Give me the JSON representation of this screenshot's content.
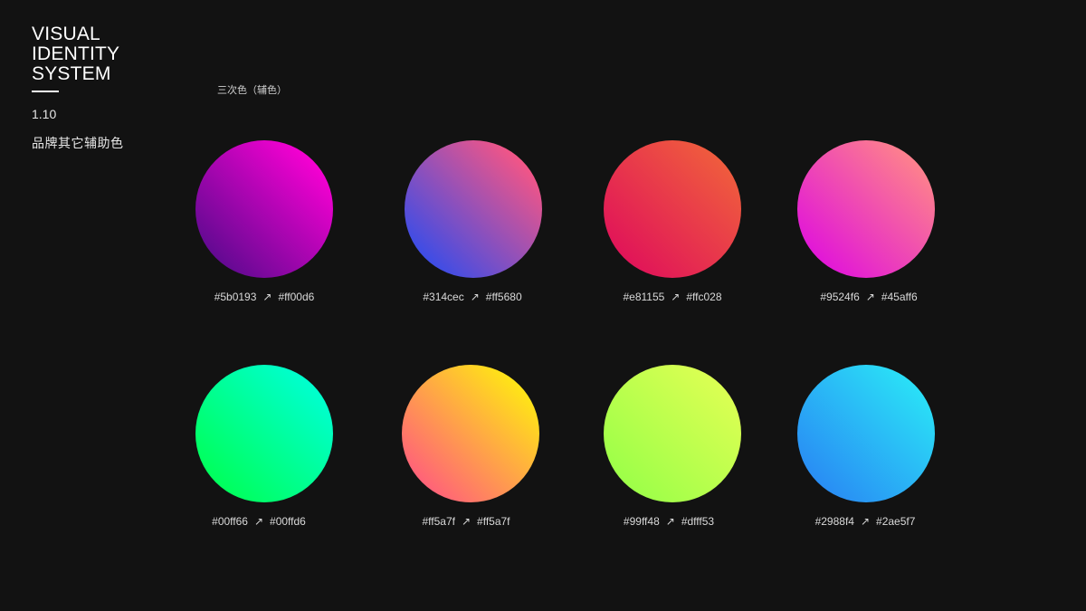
{
  "header": {
    "title_lines": [
      "VISUAL",
      "IDENTITY",
      "SYSTEM"
    ],
    "section_number": "1.10",
    "section_name": "品牌其它辅助色"
  },
  "palette": {
    "heading": "三次色（辅色）",
    "arrow_symbol": "↗",
    "swatches": [
      {
        "from": "#5b0193",
        "to": "#ff00d6"
      },
      {
        "from": "#314cec",
        "to": "#ff5680"
      },
      {
        "from": "#e81155",
        "to": "#ffc028"
      },
      {
        "from": "#9524f6",
        "to": "#45aff6"
      },
      {
        "from": "#00ff66",
        "to": "#00ffd6"
      },
      {
        "from": "#ff5a7f",
        "to": "#ff5a7f"
      },
      {
        "from": "#99ff48",
        "to": "#dfff53"
      },
      {
        "from": "#2988f4",
        "to": "#2ae5f7"
      }
    ]
  },
  "colors": {
    "background": "#121212",
    "text": "#ffffff",
    "swatch_fills": [
      [
        "#5a0a8e",
        "#ff00d6"
      ],
      [
        "#314cec",
        "#ff5680"
      ],
      [
        "#e0105a",
        "#f0603c"
      ],
      [
        "#e010dc",
        "#ff8888"
      ],
      [
        "#00ff55",
        "#00ffd6"
      ],
      [
        "#ff5a7f",
        "#ffee10"
      ],
      [
        "#99ff48",
        "#dfff53"
      ],
      [
        "#2988f4",
        "#2ae5f7"
      ]
    ]
  }
}
